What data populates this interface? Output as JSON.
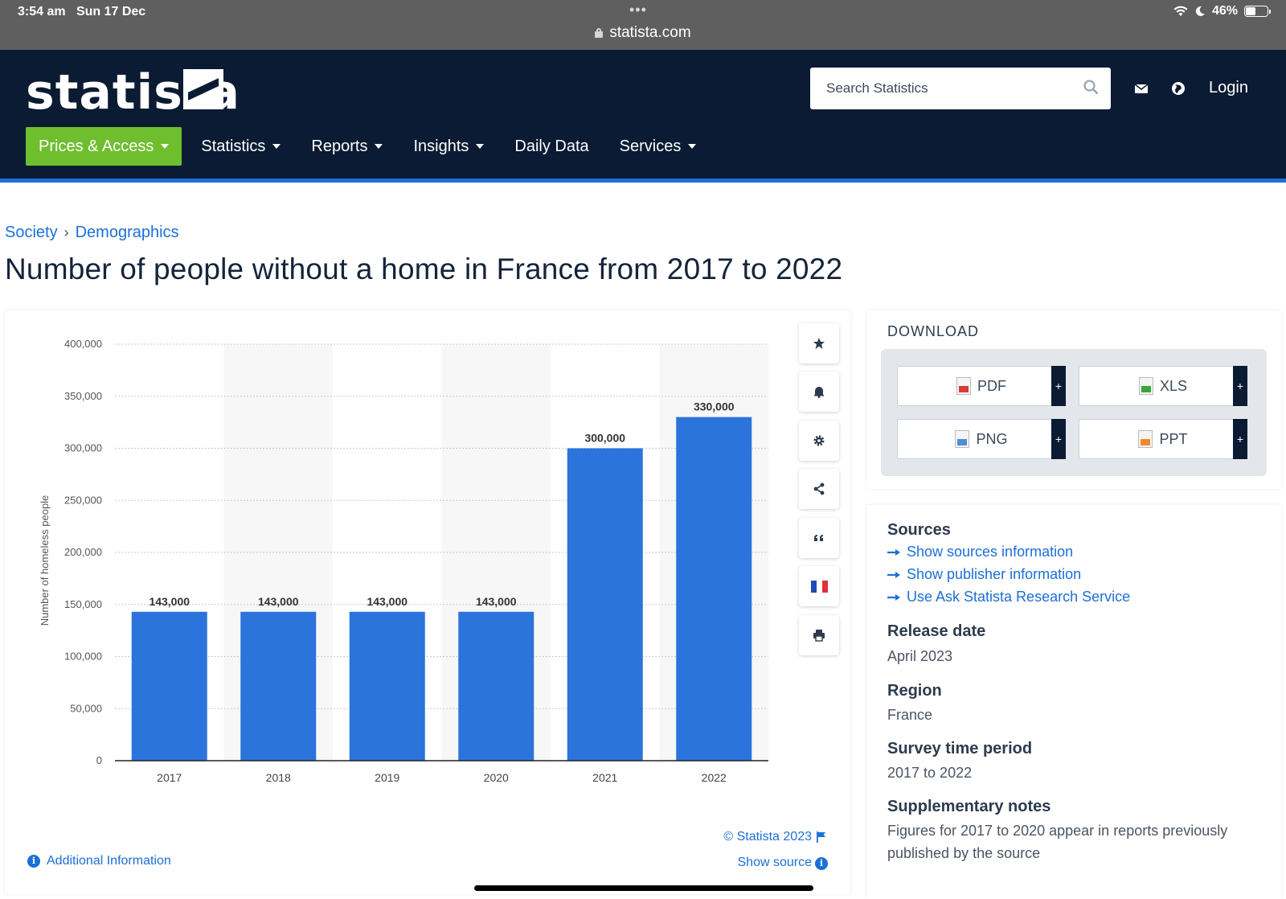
{
  "statusbar": {
    "time": "3:54 am",
    "date": "Sun 17 Dec",
    "url": "statista.com",
    "battery": "46%",
    "battery_level": 0.46
  },
  "header": {
    "logo": "statista",
    "search_placeholder": "Search Statistics",
    "login": "Login",
    "nav": [
      "Prices & Access",
      "Statistics",
      "Reports",
      "Insights",
      "Daily Data",
      "Services"
    ]
  },
  "breadcrumb": [
    "Society",
    "Demographics"
  ],
  "page_title": "Number of people without a home in France from 2017 to 2022",
  "chart_data": {
    "type": "bar",
    "categories": [
      "2017",
      "2018",
      "2019",
      "2020",
      "2021",
      "2022"
    ],
    "values": [
      143000,
      143000,
      143000,
      143000,
      300000,
      330000
    ],
    "data_labels": [
      "143,000",
      "143,000",
      "143,000",
      "143,000",
      "300,000",
      "330,000"
    ],
    "ylabel": "Number of homeless people",
    "ylim": [
      0,
      400000
    ],
    "yticks": [
      0,
      50000,
      100000,
      150000,
      200000,
      250000,
      300000,
      350000,
      400000
    ],
    "ytick_labels": [
      "0",
      "50,000",
      "100,000",
      "150,000",
      "200,000",
      "250,000",
      "300,000",
      "350,000",
      "400,000"
    ],
    "bar_color": "#2a74db",
    "grid": true
  },
  "chart_footer": {
    "copyright": "© Statista 2023",
    "show_source": "Show source",
    "additional_info": "Additional Information"
  },
  "toolbar_icons": [
    "star-icon",
    "bell-icon",
    "gear-icon",
    "share-icon",
    "quote-icon",
    "france-flag-icon",
    "print-icon"
  ],
  "download": {
    "title": "DOWNLOAD",
    "buttons": [
      "PDF",
      "XLS",
      "PNG",
      "PPT"
    ],
    "plus": "+"
  },
  "sources": {
    "title": "Sources",
    "links": [
      "Show sources information",
      "Show publisher information",
      "Use Ask Statista Research Service"
    ],
    "release_date_label": "Release date",
    "release_date": "April 2023",
    "region_label": "Region",
    "region": "France",
    "survey_label": "Survey time period",
    "survey": "2017 to 2022",
    "notes_label": "Supplementary notes",
    "notes": "Figures for 2017 to 2020 appear in reports previously published by the source"
  },
  "colors": {
    "header_bg": "#0b1b33",
    "accent_blue": "#1c6fd8",
    "prices_green": "#6fbe2e"
  }
}
